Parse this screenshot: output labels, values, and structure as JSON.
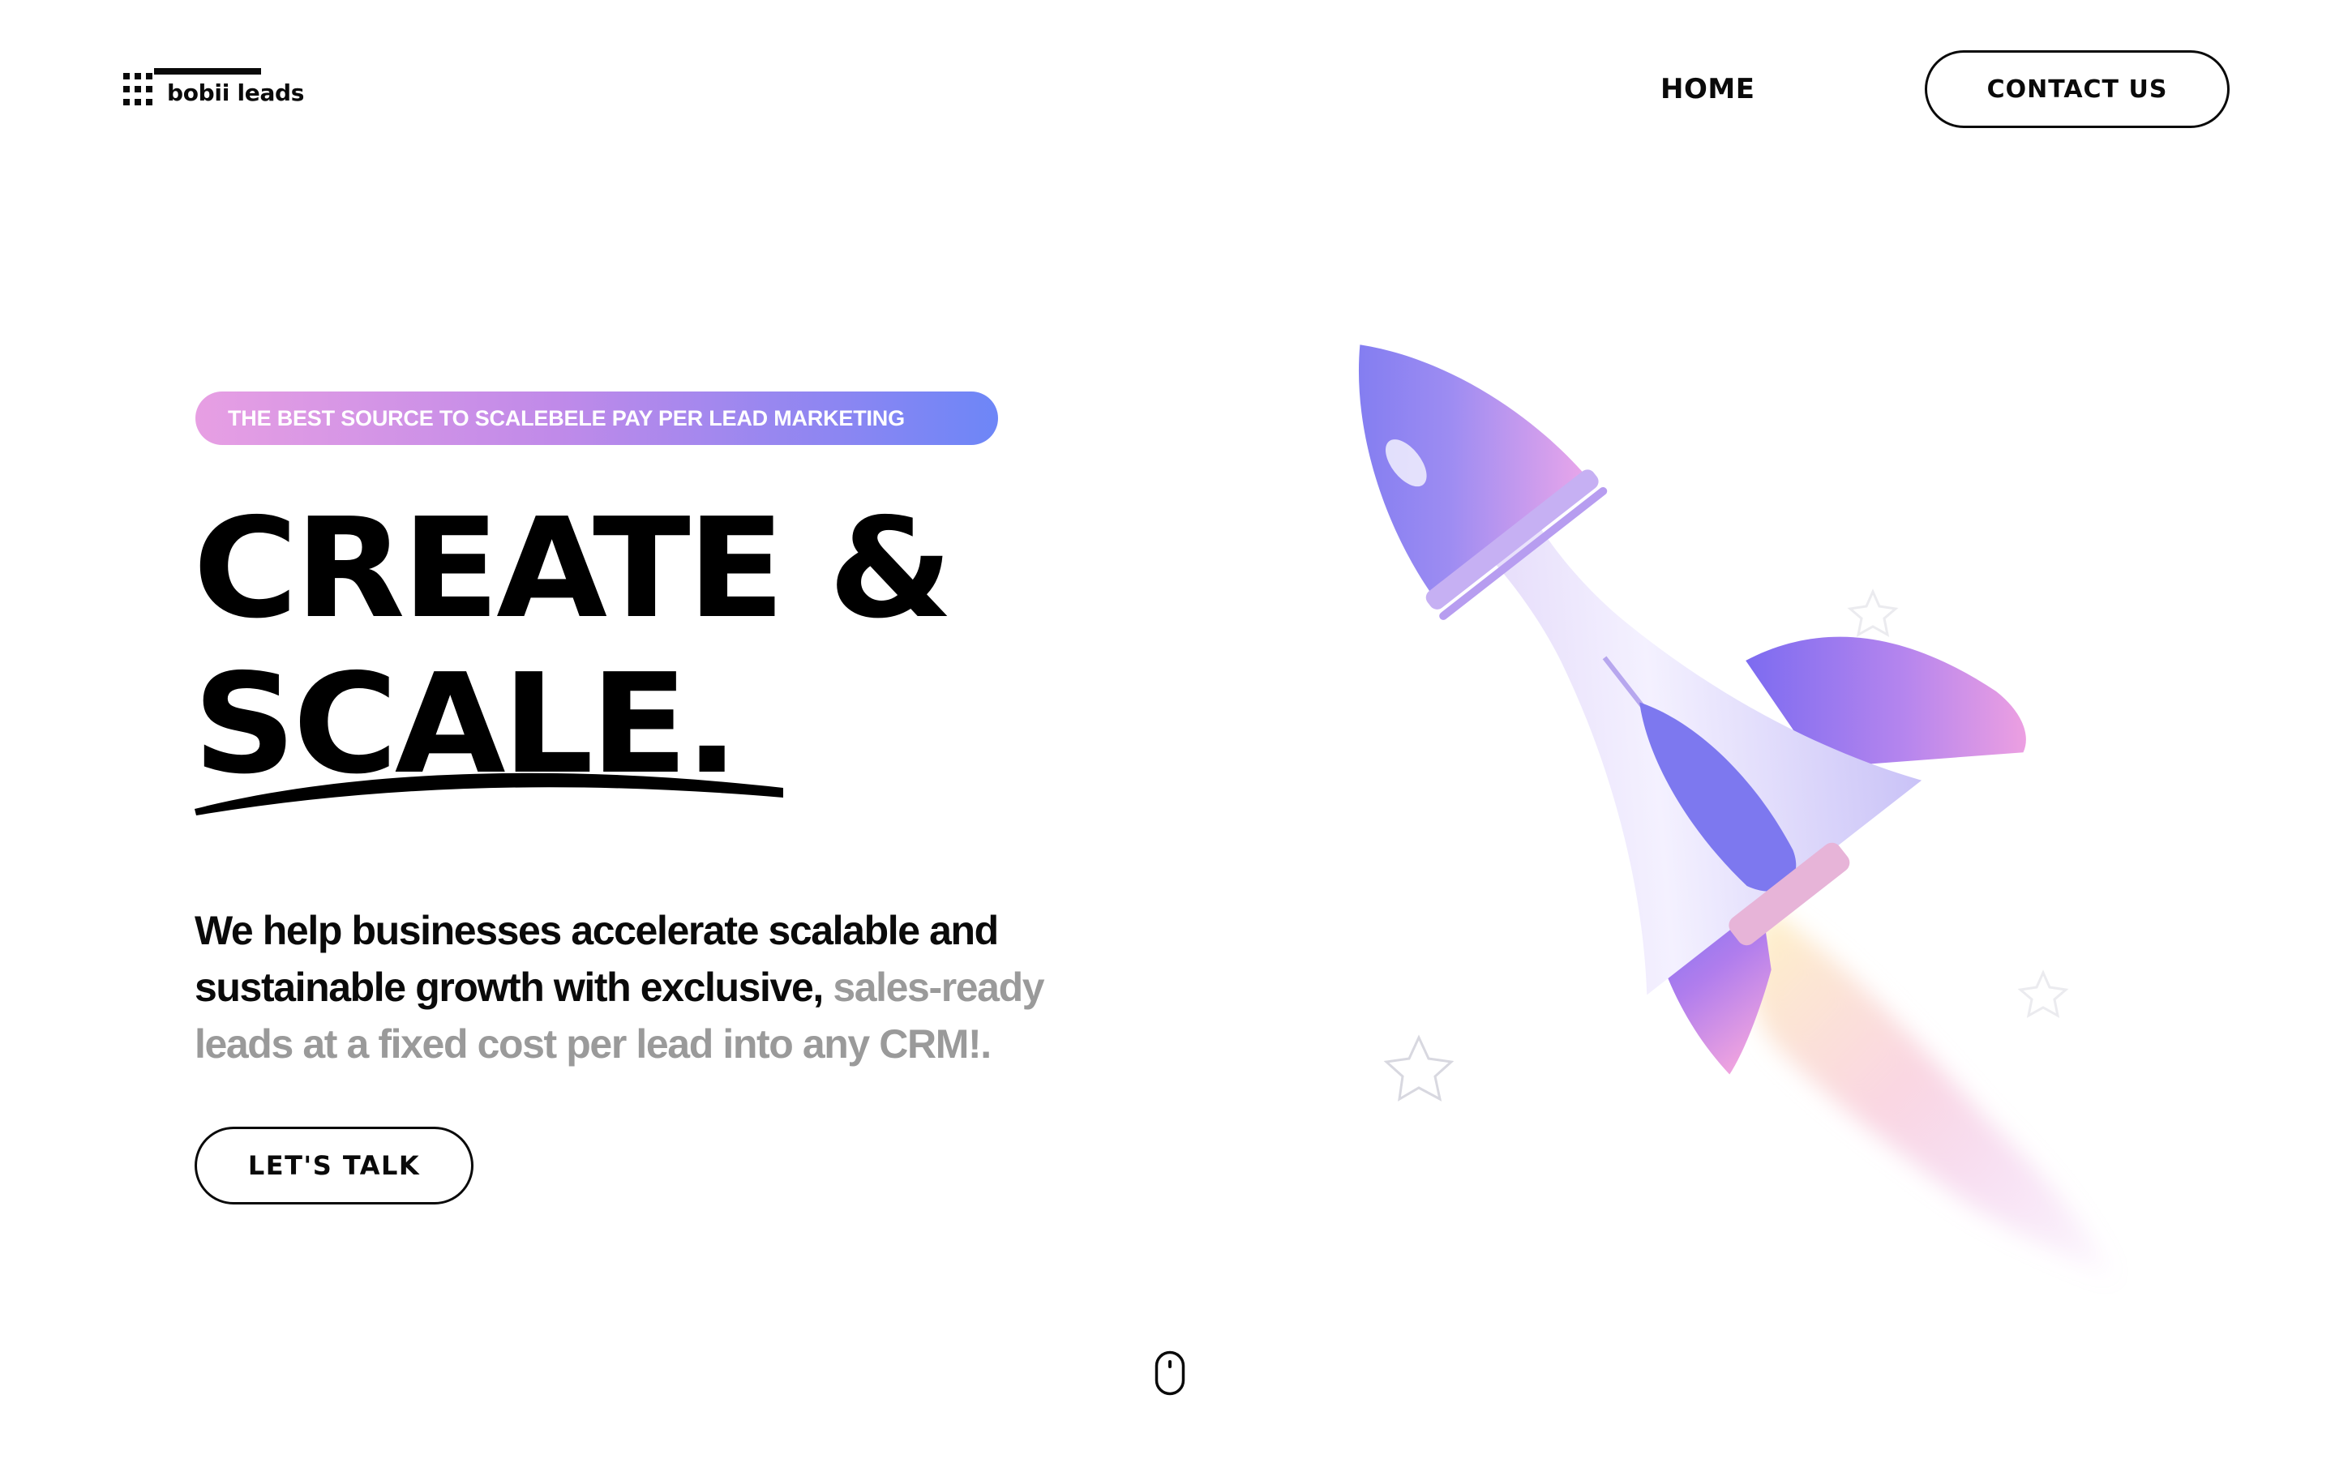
{
  "brand": {
    "name": "bobii leads",
    "logo_icon": "dot-grid-logo-icon"
  },
  "nav": {
    "home_label": "HOME",
    "contact_label": "CONTACT US"
  },
  "hero": {
    "tagline": "THE BEST SOURCE TO SCALEBELE PAY PER LEAD MARKETING",
    "headline_line1": "CREATE &",
    "headline_line2": "SCALE.",
    "lead_primary": "We help businesses accelerate scalable and sustainable growth with exclusive,",
    "lead_muted": "sales-ready leads at a fixed cost per lead into any CRM!.",
    "cta_label": "LET'S TALK",
    "illustration": "rocket-illustration"
  },
  "scroll_indicator": {
    "icon": "mouse-scroll-icon"
  },
  "colors": {
    "text": "#0a0a0a",
    "muted_text": "#9a9a9a",
    "tagline_gradient_start": "#e79fe3",
    "tagline_gradient_end": "#6d86f7",
    "background": "#ffffff"
  }
}
